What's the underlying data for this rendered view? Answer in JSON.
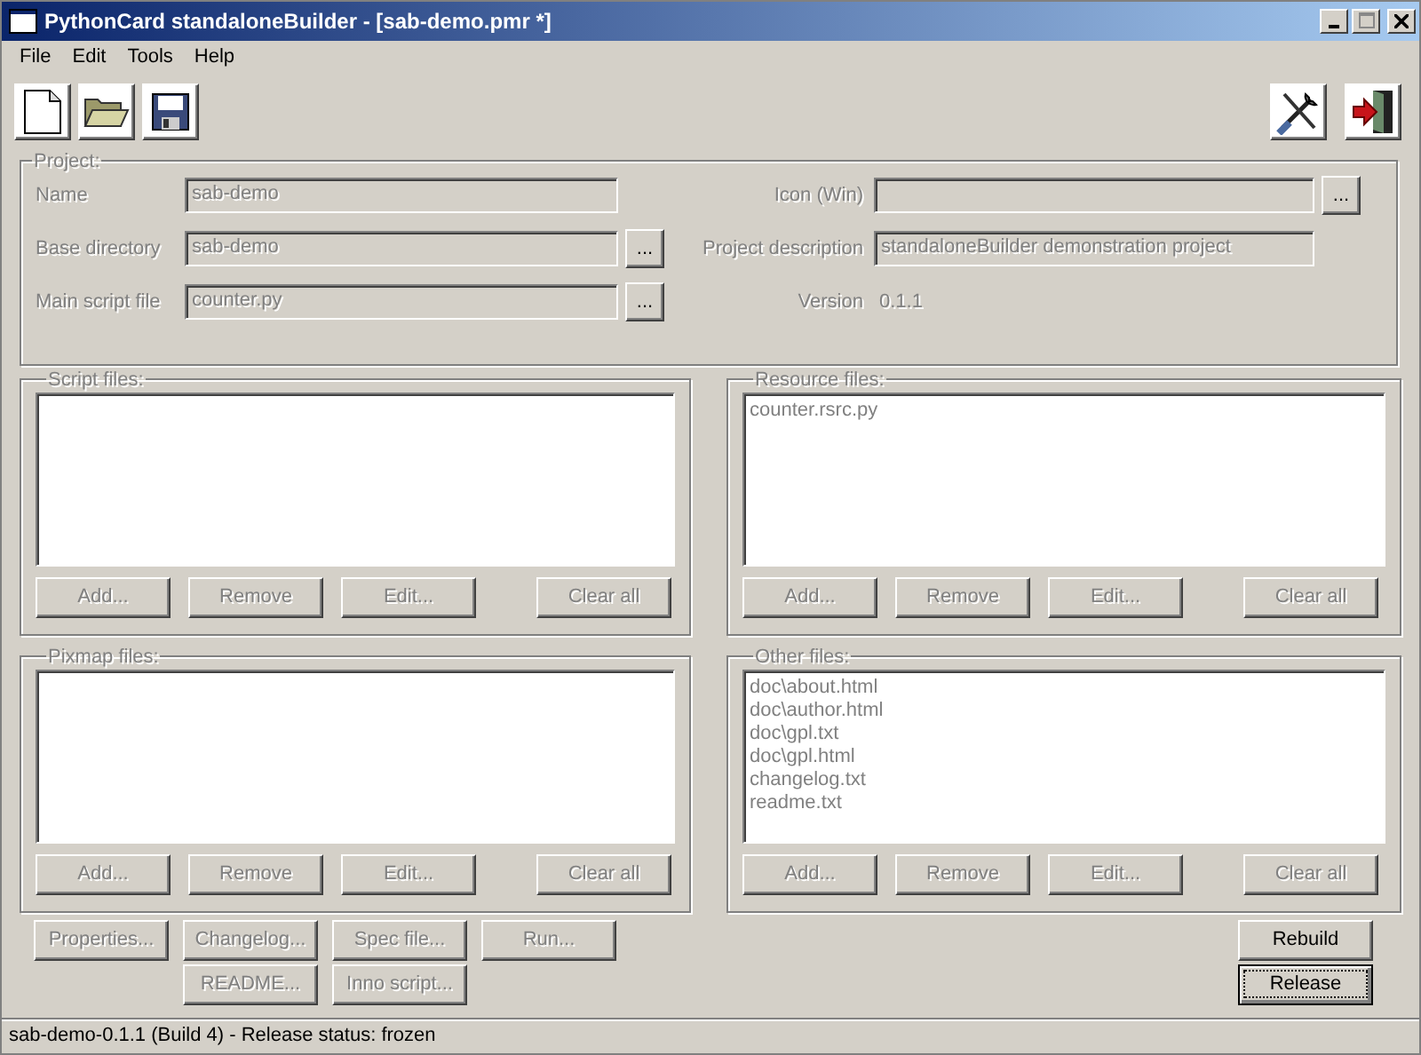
{
  "window": {
    "title": "PythonCard standaloneBuilder - [sab-demo.pmr *]"
  },
  "menu": [
    {
      "label": "File"
    },
    {
      "label": "Edit"
    },
    {
      "label": "Tools"
    },
    {
      "label": "Help"
    }
  ],
  "project": {
    "label": "Project:",
    "left": [
      {
        "label": "Name",
        "kind": "field",
        "value": "sab-demo",
        "disabled": true
      },
      {
        "label": "Base directory",
        "kind": "field",
        "value": "sab-demo",
        "disabled": true,
        "browse": "..."
      },
      {
        "label": "Main script file",
        "kind": "field",
        "value": "counter.py",
        "disabled": true,
        "browse": "..."
      }
    ],
    "right": [
      {
        "label": "Icon (Win)",
        "kind": "field",
        "disabled": true,
        "browse": "..."
      },
      {
        "label": "Project description",
        "kind": "field",
        "value": "standaloneBuilder demonstration project",
        "disabled": true
      },
      {
        "label": "Version",
        "kind": "text",
        "value": "0.1.1",
        "disabled": true
      }
    ]
  },
  "groups": [
    {
      "label": "Script files:",
      "buttons": [
        {
          "label": "Add...",
          "disabled": true
        },
        {
          "label": "Remove",
          "disabled": true
        },
        {
          "label": "Edit...",
          "disabled": true
        },
        {
          "label": "Clear all",
          "disabled": true
        }
      ]
    },
    {
      "label": "Resource files:",
      "items": [
        "counter.rsrc.py"
      ],
      "buttons": [
        {
          "label": "Add...",
          "disabled": true
        },
        {
          "label": "Remove",
          "disabled": true
        },
        {
          "label": "Edit...",
          "disabled": true
        },
        {
          "label": "Clear all",
          "disabled": true
        }
      ]
    },
    {
      "label": "Pixmap files:",
      "buttons": [
        {
          "label": "Add...",
          "disabled": true
        },
        {
          "label": "Remove",
          "disabled": true
        },
        {
          "label": "Edit...",
          "disabled": true
        },
        {
          "label": "Clear all",
          "disabled": true
        }
      ]
    },
    {
      "label": "Other files:",
      "items": [
        "doc\\about.html",
        "doc\\author.html",
        "doc\\gpl.txt",
        "doc\\gpl.html",
        "changelog.txt",
        "readme.txt"
      ],
      "buttons": [
        {
          "label": "Add...",
          "disabled": true
        },
        {
          "label": "Remove",
          "disabled": true
        },
        {
          "label": "Edit...",
          "disabled": true
        },
        {
          "label": "Clear all",
          "disabled": true
        }
      ]
    }
  ],
  "actions": [
    [
      {
        "label": "Properties...",
        "disabled": true
      },
      {
        "label": "Changelog...",
        "disabled": true
      },
      {
        "label": "Spec file...",
        "disabled": true
      },
      {
        "label": "Run...",
        "disabled": true
      }
    ],
    [
      {
        "label": "README...",
        "disabled": true
      },
      {
        "label": "Inno script...",
        "disabled": true
      }
    ]
  ],
  "release_buttons": [
    {
      "label": "Rebuild",
      "disabled": false,
      "focused": false
    },
    {
      "label": "Release",
      "disabled": false,
      "focused": true
    }
  ],
  "status_bar": "sab-demo-0.1.1 (Build 4) - Release status: frozen"
}
